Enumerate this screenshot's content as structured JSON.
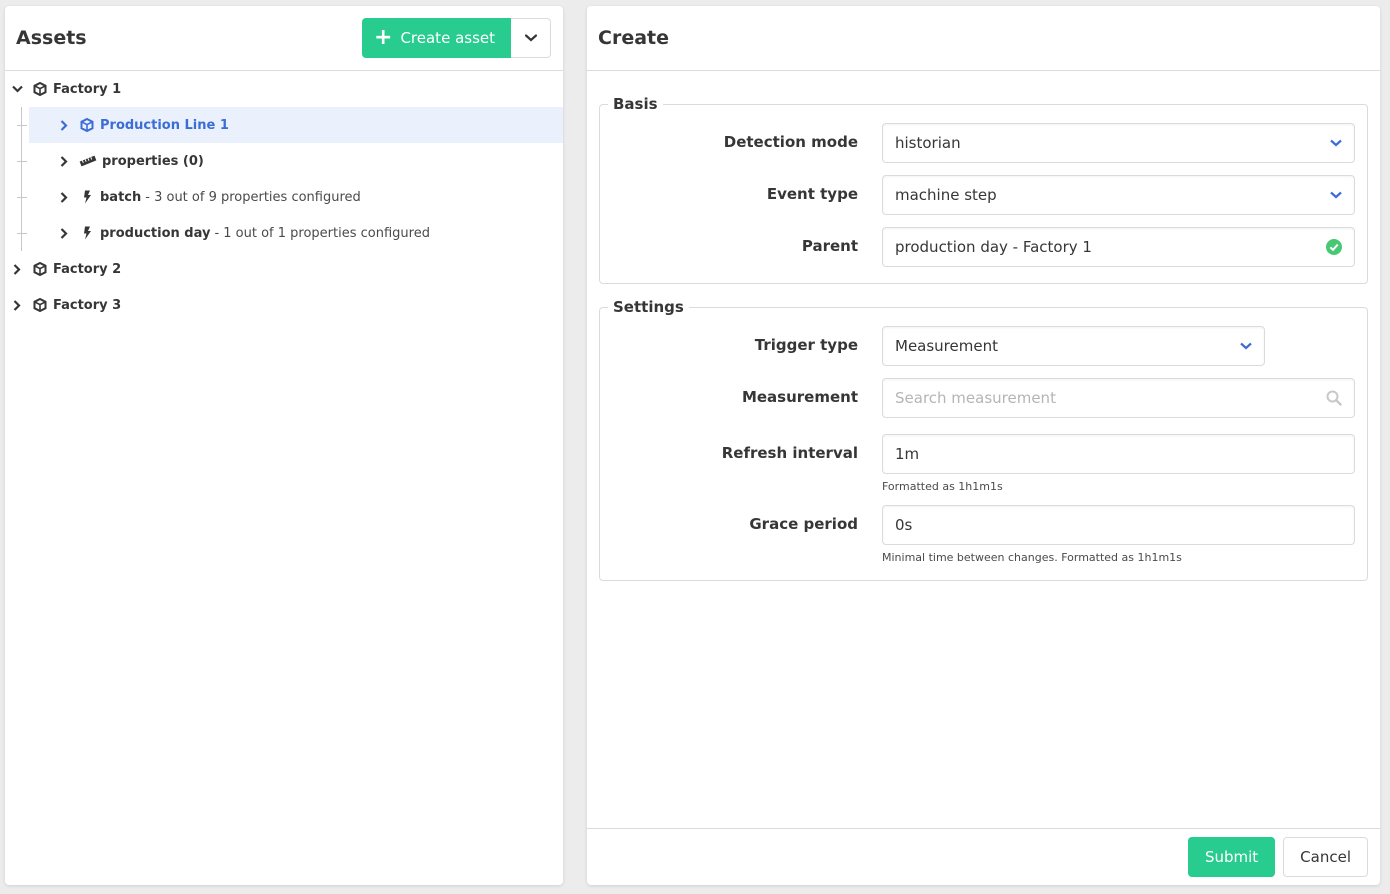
{
  "assets": {
    "title": "Assets",
    "create_button": "Create asset",
    "tree": {
      "factory1": {
        "label": "Factory 1",
        "expanded": true
      },
      "children": [
        {
          "name": "Production Line 1",
          "desc": "",
          "icon": "cube-icon",
          "selected": true
        },
        {
          "name": "properties (0)",
          "desc": "",
          "icon": "ruler-icon",
          "selected": false
        },
        {
          "name": "batch",
          "desc": "- 3 out of 9 properties configured",
          "icon": "bolt-icon",
          "selected": false
        },
        {
          "name": "production day",
          "desc": "- 1 out of 1 properties configured",
          "icon": "bolt-icon",
          "selected": false
        }
      ],
      "factory2": {
        "label": "Factory 2"
      },
      "factory3": {
        "label": "Factory 3"
      }
    }
  },
  "create": {
    "title": "Create",
    "basis": {
      "legend": "Basis",
      "detection_mode": {
        "label": "Detection mode",
        "value": "historian"
      },
      "event_type": {
        "label": "Event type",
        "value": "machine step"
      },
      "parent": {
        "label": "Parent",
        "value": "production day - Factory 1"
      }
    },
    "settings": {
      "legend": "Settings",
      "trigger_type": {
        "label": "Trigger type",
        "value": "Measurement"
      },
      "measurement": {
        "label": "Measurement",
        "placeholder": "Search measurement"
      },
      "refresh_interval": {
        "label": "Refresh interval",
        "value": "1m",
        "help": "Formatted as 1h1m1s"
      },
      "grace_period": {
        "label": "Grace period",
        "value": "0s",
        "help": "Minimal time between changes. Formatted as 1h1m1s"
      }
    },
    "submit_label": "Submit",
    "cancel_label": "Cancel"
  },
  "colors": {
    "primary": "#28cc8f",
    "link": "#3c6dd6",
    "selected_bg": "#ebf1fc",
    "success": "#48c774"
  }
}
